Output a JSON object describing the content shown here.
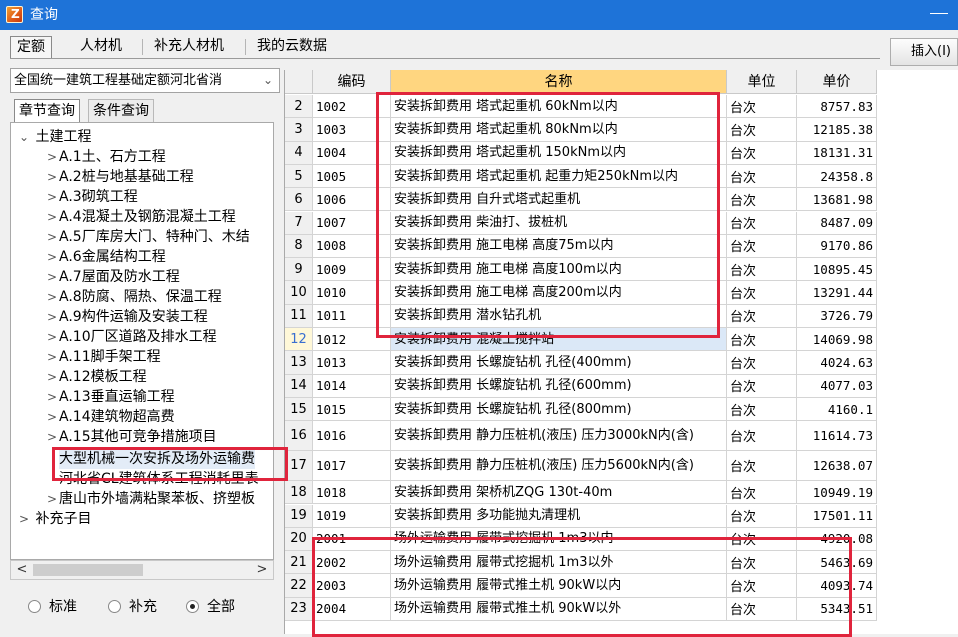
{
  "window": {
    "title": "查询"
  },
  "tabs": [
    "定额",
    "人材机",
    "补充人材机",
    "我的云数据"
  ],
  "insert_button": "插入(I)",
  "library": {
    "selected": "全国统一建筑工程基础定额河北省消"
  },
  "subtabs": [
    "章节查询",
    "条件查询"
  ],
  "tree": [
    {
      "label": "土建工程",
      "level": 0,
      "expanded": true
    },
    {
      "label": "A.1土、石方工程",
      "level": 1
    },
    {
      "label": "A.2桩与地基基础工程",
      "level": 1
    },
    {
      "label": "A.3砌筑工程",
      "level": 1
    },
    {
      "label": "A.4混凝土及钢筋混凝土工程",
      "level": 1
    },
    {
      "label": "A.5厂库房大门、特种门、木结",
      "level": 1
    },
    {
      "label": "A.6金属结构工程",
      "level": 1
    },
    {
      "label": "A.7屋面及防水工程",
      "level": 1
    },
    {
      "label": "A.8防腐、隔热、保温工程",
      "level": 1
    },
    {
      "label": "A.9构件运输及安装工程",
      "level": 1
    },
    {
      "label": "A.10厂区道路及排水工程",
      "level": 1
    },
    {
      "label": "A.11脚手架工程",
      "level": 1
    },
    {
      "label": "A.12模板工程",
      "level": 1
    },
    {
      "label": "A.13垂直运输工程",
      "level": 1
    },
    {
      "label": "A.14建筑物超高费",
      "level": 1
    },
    {
      "label": "A.15其他可竞争措施项目",
      "level": 1
    },
    {
      "label": "大型机械一次安拆及场外运输费",
      "level": 1,
      "selected": true
    },
    {
      "label": "河北省CL建筑体系工程消耗里表",
      "level": 1
    },
    {
      "label": "唐山市外墙满粘聚苯板、挤塑板",
      "level": 1
    },
    {
      "label": "补充子目",
      "level": 0,
      "expanded": false
    }
  ],
  "radio": {
    "options": [
      "标准",
      "补充",
      "全部"
    ],
    "selected": "全部"
  },
  "grid": {
    "columns": [
      "",
      "编码",
      "名称",
      "单位",
      "单价"
    ],
    "rows": [
      {
        "n": "2",
        "code": "1002",
        "name": "安装拆卸费用 塔式起重机 60kNm以内",
        "unit": "台次",
        "price": "8757.83"
      },
      {
        "n": "3",
        "code": "1003",
        "name": "安装拆卸费用 塔式起重机 80kNm以内",
        "unit": "台次",
        "price": "12185.38"
      },
      {
        "n": "4",
        "code": "1004",
        "name": "安装拆卸费用 塔式起重机 150kNm以内",
        "unit": "台次",
        "price": "18131.31"
      },
      {
        "n": "5",
        "code": "1005",
        "name": "安装拆卸费用 塔式起重机 起重力矩250kNm以内",
        "unit": "台次",
        "price": "24358.8"
      },
      {
        "n": "6",
        "code": "1006",
        "name": "安装拆卸费用 自升式塔式起重机",
        "unit": "台次",
        "price": "13681.98"
      },
      {
        "n": "7",
        "code": "1007",
        "name": "安装拆卸费用 柴油打、拔桩机",
        "unit": "台次",
        "price": "8487.09"
      },
      {
        "n": "8",
        "code": "1008",
        "name": "安装拆卸费用 施工电梯 高度75m以内",
        "unit": "台次",
        "price": "9170.86"
      },
      {
        "n": "9",
        "code": "1009",
        "name": "安装拆卸费用 施工电梯 高度100m以内",
        "unit": "台次",
        "price": "10895.45"
      },
      {
        "n": "10",
        "code": "1010",
        "name": "安装拆卸费用 施工电梯 高度200m以内",
        "unit": "台次",
        "price": "13291.44"
      },
      {
        "n": "11",
        "code": "1011",
        "name": "安装拆卸费用 潜水钻孔机",
        "unit": "台次",
        "price": "3726.79"
      },
      {
        "n": "12",
        "code": "1012",
        "name": "安装拆卸费用 混凝土搅拌站",
        "unit": "台次",
        "price": "14069.98",
        "current": true
      },
      {
        "n": "13",
        "code": "1013",
        "name": "安装拆卸费用 长螺旋钻机 孔径(400mm)",
        "unit": "台次",
        "price": "4024.63"
      },
      {
        "n": "14",
        "code": "1014",
        "name": "安装拆卸费用 长螺旋钻机 孔径(600mm)",
        "unit": "台次",
        "price": "4077.03"
      },
      {
        "n": "15",
        "code": "1015",
        "name": "安装拆卸费用 长螺旋钻机 孔径(800mm)",
        "unit": "台次",
        "price": "4160.1"
      },
      {
        "n": "16",
        "code": "1016",
        "name": "安装拆卸费用 静力压桩机(液压) 压力3000kN内(含)",
        "unit": "台次",
        "price": "11614.73",
        "tall": true
      },
      {
        "n": "17",
        "code": "1017",
        "name": "安装拆卸费用 静力压桩机(液压) 压力5600kN内(含)",
        "unit": "台次",
        "price": "12638.07",
        "tall": true
      },
      {
        "n": "18",
        "code": "1018",
        "name": "安装拆卸费用 架桥机ZQG 130t-40m",
        "unit": "台次",
        "price": "10949.19"
      },
      {
        "n": "19",
        "code": "1019",
        "name": "安装拆卸费用 多功能抛丸清理机",
        "unit": "台次",
        "price": "17501.11"
      },
      {
        "n": "20",
        "code": "2001",
        "name": "场外运输费用 履带式挖掘机 1m3以内",
        "unit": "台次",
        "price": "4920.08"
      },
      {
        "n": "21",
        "code": "2002",
        "name": "场外运输费用 履带式挖掘机 1m3以外",
        "unit": "台次",
        "price": "5463.69"
      },
      {
        "n": "22",
        "code": "2003",
        "name": "场外运输费用 履带式推土机 90kW以内",
        "unit": "台次",
        "price": "4093.74"
      },
      {
        "n": "23",
        "code": "2004",
        "name": "场外运输费用 履带式推土机 90kW以外",
        "unit": "台次",
        "price": "5343.51"
      }
    ]
  }
}
